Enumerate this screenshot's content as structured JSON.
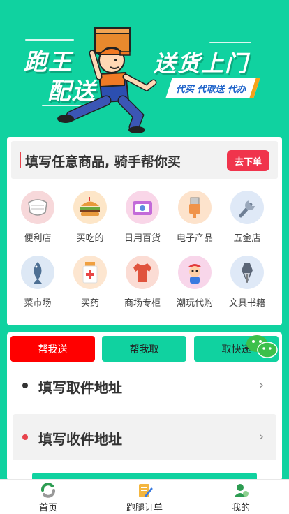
{
  "banner": {
    "title_line1": "跑王",
    "title_line2": "配送",
    "slogan": "送货上门",
    "tagline": "代买 代取送 代办"
  },
  "promo": {
    "text": "填写任意商品, 骑手帮你买",
    "button_label": "去下单"
  },
  "categories": [
    {
      "label": "便利店",
      "icon": "mask-icon"
    },
    {
      "label": "买吃的",
      "icon": "burger-icon"
    },
    {
      "label": "日用百货",
      "icon": "tissue-pack-icon"
    },
    {
      "label": "电子产品",
      "icon": "usb-cable-icon"
    },
    {
      "label": "五金店",
      "icon": "wrench-icon"
    },
    {
      "label": "菜市场",
      "icon": "fish-icon"
    },
    {
      "label": "买药",
      "icon": "medicine-bottle-icon"
    },
    {
      "label": "商场专柜",
      "icon": "shirt-icon"
    },
    {
      "label": "潮玩代购",
      "icon": "figure-toy-icon"
    },
    {
      "label": "文具书籍",
      "icon": "fountain-pen-icon"
    }
  ],
  "order_tabs": [
    {
      "label": "帮我送",
      "active": true
    },
    {
      "label": "帮我取",
      "active": false
    },
    {
      "label": "取快递",
      "active": false
    }
  ],
  "address": {
    "pickup_label": "填写取件地址",
    "delivery_label": "填写收件地址",
    "pickup_dot_color": "#333333",
    "delivery_dot_color": "#e8434c"
  },
  "bottom_nav": [
    {
      "label": "首页",
      "icon": "home-swirl-icon"
    },
    {
      "label": "跑腿订单",
      "icon": "order-notepad-icon"
    },
    {
      "label": "我的",
      "icon": "user-icon"
    }
  ],
  "colors": {
    "brand": "#10d2a0",
    "active_tab": "#ff0000",
    "accent_red": "#f0344c"
  }
}
